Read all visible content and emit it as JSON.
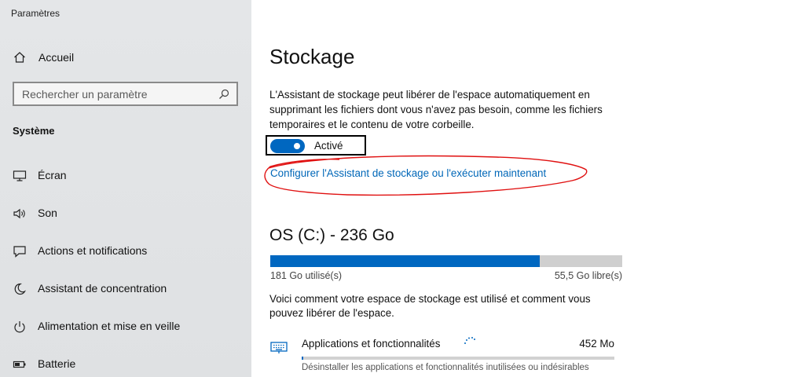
{
  "app": {
    "title": "Paramètres"
  },
  "sidebar": {
    "home_label": "Accueil",
    "search_placeholder": "Rechercher un paramètre",
    "section_label": "Système",
    "items": [
      {
        "label": "Écran",
        "icon": "monitor-icon"
      },
      {
        "label": "Son",
        "icon": "speaker-icon"
      },
      {
        "label": "Actions et notifications",
        "icon": "notification-icon"
      },
      {
        "label": "Assistant de concentration",
        "icon": "moon-icon"
      },
      {
        "label": "Alimentation et mise en veille",
        "icon": "power-icon"
      },
      {
        "label": "Batterie",
        "icon": "battery-icon"
      }
    ]
  },
  "main": {
    "title": "Stockage",
    "description": "L'Assistant de stockage peut libérer de l'espace automatiquement en supprimant les fichiers dont vous n'avez pas besoin, comme les fichiers temporaires et le contenu de votre corbeille.",
    "toggle": {
      "label": "Activé",
      "on": true
    },
    "config_link": "Configurer l'Assistant de stockage ou l'exécuter maintenant",
    "drive": {
      "title": "OS (C:) - 236 Go",
      "used_label": "181 Go utilisé(s)",
      "free_label": "55,5 Go libre(s)",
      "used_fraction": 0.766
    },
    "usage_description": "Voici comment votre espace de stockage est utilisé et comment vous pouvez libérer de l'espace.",
    "categories": [
      {
        "name": "Applications et fonctionnalités",
        "size": "452 Mo",
        "subtitle": "Désinstaller les applications et fonctionnalités inutilisées ou indésirables",
        "fill_fraction": 0.004
      }
    ]
  },
  "colors": {
    "accent": "#0067c0",
    "link": "#0067b8",
    "annotation": "#e01010",
    "sidebar_bg": "#e2e4e6"
  }
}
